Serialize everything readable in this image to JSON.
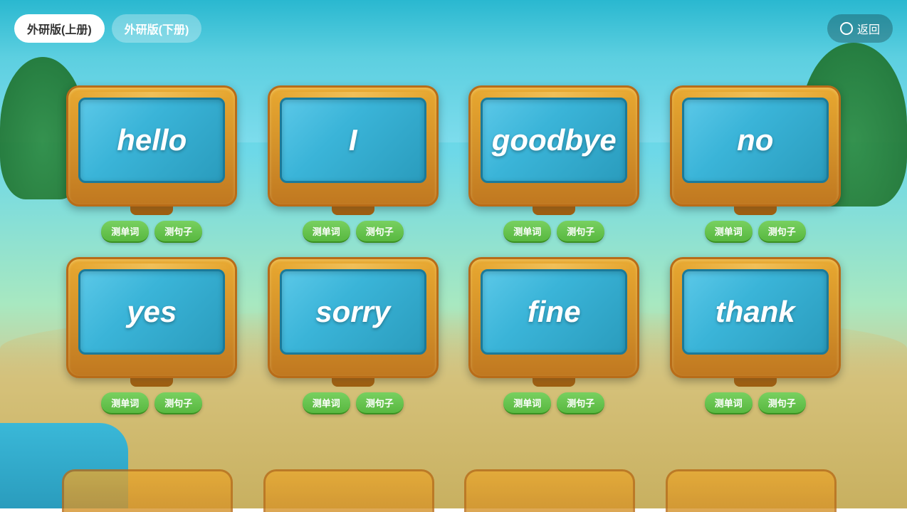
{
  "nav": {
    "tab1": "外研版(上册)",
    "tab2": "外研版(下册)",
    "return_label": "返回"
  },
  "row1": [
    {
      "word": "hello",
      "btn1": "测单词",
      "btn2": "测句子"
    },
    {
      "word": "I",
      "btn1": "测单词",
      "btn2": "测句子"
    },
    {
      "word": "goodbye",
      "btn1": "测单词",
      "btn2": "测句子"
    },
    {
      "word": "no",
      "btn1": "测单词",
      "btn2": "测句子"
    }
  ],
  "row2": [
    {
      "word": "yes",
      "btn1": "测单词",
      "btn2": "测句子"
    },
    {
      "word": "sorry",
      "btn1": "测单词",
      "btn2": "测句子"
    },
    {
      "word": "fine",
      "btn1": "测单词",
      "btn2": "测句子"
    },
    {
      "word": "thank",
      "btn1": "测单词",
      "btn2": "测句子"
    }
  ]
}
